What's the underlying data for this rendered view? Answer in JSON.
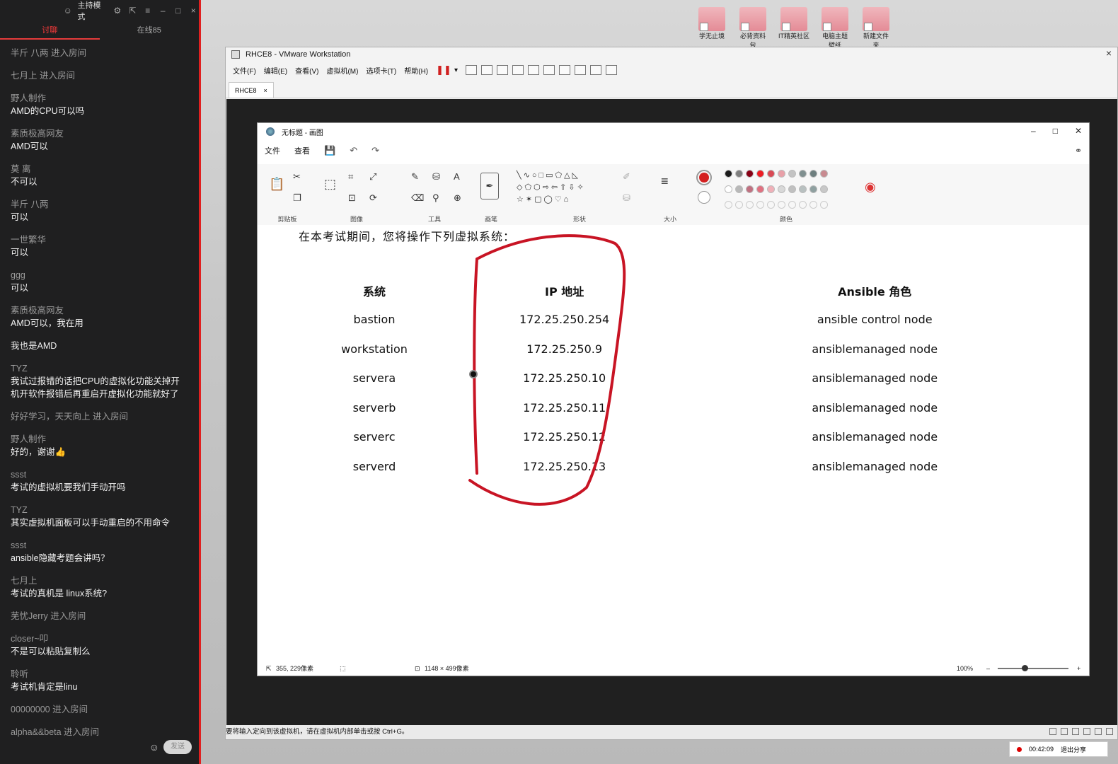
{
  "chat": {
    "mode_label": "主持模式",
    "tabs": [
      "讨聊",
      "在线85"
    ],
    "messages": [
      {
        "user": "",
        "text": "",
        "sys": "半斤 八两 进入房间"
      },
      {
        "user": "",
        "text": "",
        "sys": "七月上 进入房间"
      },
      {
        "user": "野人制作",
        "text": "AMD的CPU可以吗",
        "sys": ""
      },
      {
        "user": "素质极高网友",
        "text": "AMD可以",
        "sys": ""
      },
      {
        "user": "莫 离",
        "text": "不可以",
        "sys": ""
      },
      {
        "user": "半斤 八两",
        "text": "可以",
        "sys": ""
      },
      {
        "user": "一世繁华",
        "text": "可以",
        "sys": ""
      },
      {
        "user": "ggg",
        "text": "可以",
        "sys": ""
      },
      {
        "user": "素质极高网友",
        "text": "AMD可以，我在用",
        "sys": ""
      },
      {
        "user": "",
        "text": "我也是AMD",
        "sys": ""
      },
      {
        "user": "TYZ",
        "text": "我试过报错的话把CPU的虚拟化功能关掉开机开软件报错后再重启开虚拟化功能就好了",
        "sys": ""
      },
      {
        "user": "",
        "text": "",
        "sys": "好好学习，天天向上 进入房间"
      },
      {
        "user": "野人制作",
        "text": "好的，谢谢👍",
        "sys": ""
      },
      {
        "user": "ssst",
        "text": "考试的虚拟机要我们手动开吗",
        "sys": ""
      },
      {
        "user": "TYZ",
        "text": "其实虚拟机面板可以手动重启的不用命令",
        "sys": ""
      },
      {
        "user": "ssst",
        "text": "ansible隐藏考题会讲吗？",
        "sys": ""
      },
      {
        "user": "七月上",
        "text": "考试的真机是 linux系统?",
        "sys": ""
      },
      {
        "user": "",
        "text": "",
        "sys": "芜忧Jerry 进入房间"
      },
      {
        "user": "closer~叩",
        "text": "不是可以粘贴复制么",
        "sys": ""
      },
      {
        "user": "聆听",
        "text": "考试机肯定是linu",
        "sys": ""
      },
      {
        "user": "",
        "text": "",
        "sys": "00000000 进入房间"
      },
      {
        "user": "",
        "text": "",
        "sys": "alpha&&beta 进入房间"
      }
    ],
    "send_label": "发送"
  },
  "desktop_icons": [
    "学无止境",
    "必背资料包",
    "IT精英社区",
    "电脑主题壁纸",
    "新建文件夹"
  ],
  "vmware": {
    "title": "RHCE8 - VMware Workstation",
    "menu": [
      "文件(F)",
      "编辑(E)",
      "查看(V)",
      "虚拟机(M)",
      "选项卡(T)",
      "帮助(H)"
    ],
    "tab": "RHCE8",
    "status_text": "要将输入定向到该虚拟机，请在虚拟机内部单击或按 Ctrl+G。"
  },
  "paint": {
    "title": "无标题 - 画图",
    "menu": [
      "文件",
      "查看"
    ],
    "groups": [
      "剪贴板",
      "图像",
      "工具",
      "画笔",
      "形状",
      "大小",
      "颜色"
    ],
    "palette_row1": [
      "#1a1a1a",
      "#7f7f7f",
      "#880015",
      "#ed1c24",
      "#d94a55",
      "#e8a0a8",
      "#c3c3c3",
      "#7f8f8f",
      "#6e7f7f",
      "#c88a90"
    ],
    "palette_row2": [
      "#ffffff",
      "#b8b8b8",
      "#c07080",
      "#e07080",
      "#f0b0b8",
      "#d8d8d8",
      "#c0c0c0",
      "#b8c0c0",
      "#8fa0a0",
      "#c8c8c8"
    ],
    "primary_color": "#d42020",
    "intro": "在本考试期间，您将操作下列虚拟系统：",
    "table": {
      "headers": [
        "系统",
        "IP 地址",
        "Ansible 角色"
      ],
      "rows": [
        [
          "bastion",
          "172.25.250.254",
          "ansible control node"
        ],
        [
          "workstation",
          "172.25.250.9",
          "ansiblemanaged node"
        ],
        [
          "servera",
          "172.25.250.10",
          "ansiblemanaged node"
        ],
        [
          "serverb",
          "172.25.250.11",
          "ansiblemanaged node"
        ],
        [
          "serverc",
          "172.25.250.12",
          "ansiblemanaged node"
        ],
        [
          "serverd",
          "172.25.250.13",
          "ansiblemanaged node"
        ]
      ]
    },
    "status": {
      "cursor": "355, 229像素",
      "size": "1148 × 499像素",
      "zoom": "100%"
    }
  },
  "recording": {
    "time": "00:42:09",
    "exit_label": "退出分享"
  }
}
